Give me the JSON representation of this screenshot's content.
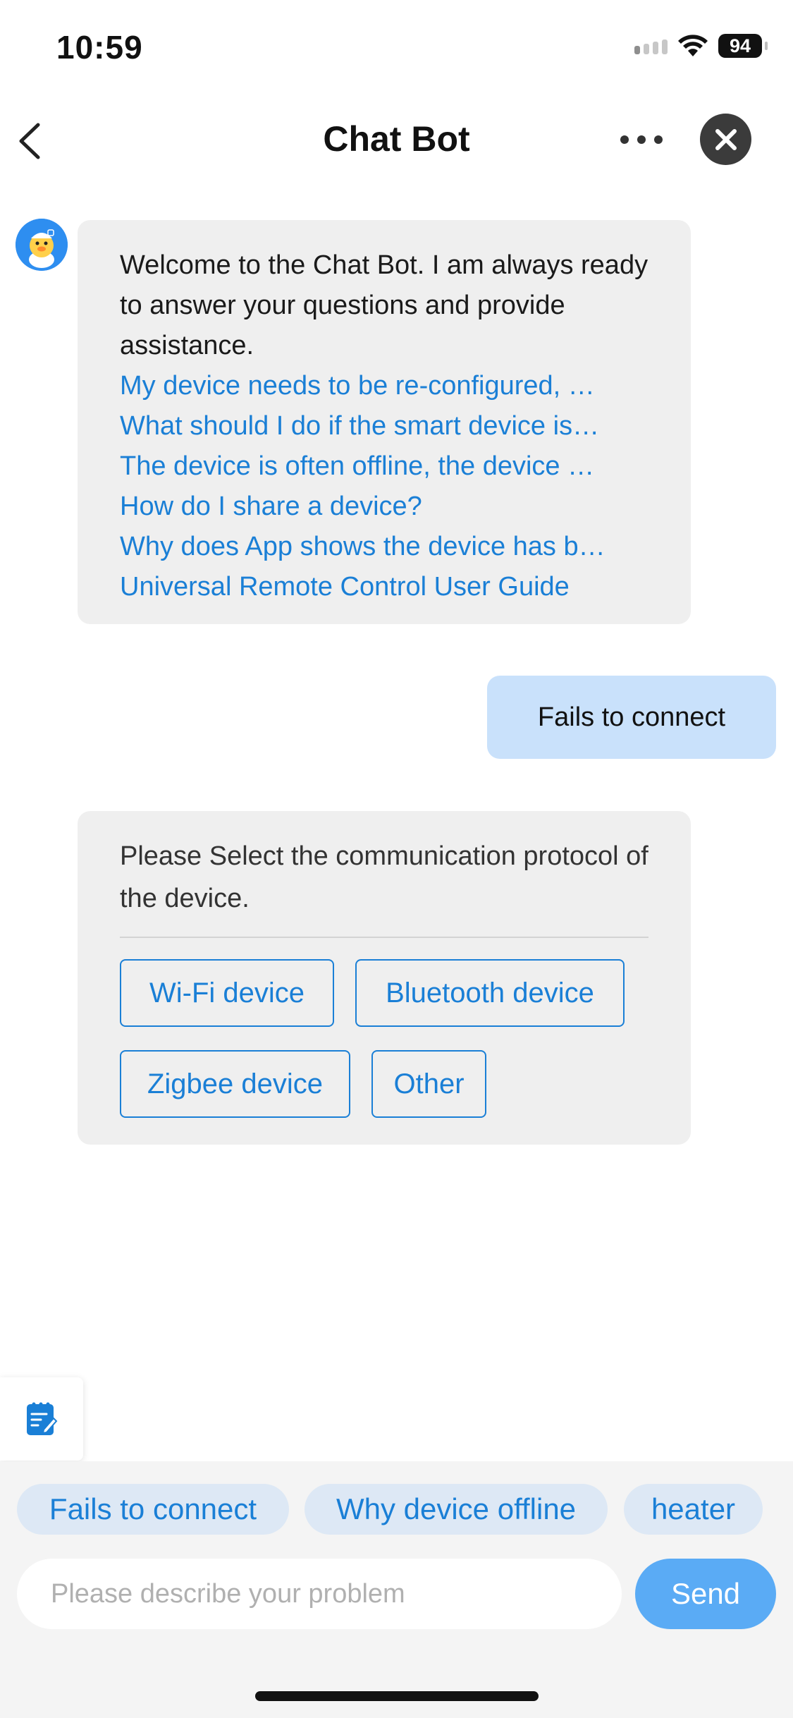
{
  "status_bar": {
    "time": "10:59",
    "battery": "94"
  },
  "header": {
    "title": "Chat Bot",
    "back_icon": "chevron-left-icon",
    "more_icon": "more-horizontal-icon",
    "close_icon": "close-icon"
  },
  "messages": {
    "welcome": {
      "text": "Welcome to the Chat Bot. I am always ready to answer your questions and provide assistance.",
      "links": [
        "My device needs to be re-configured, …",
        "What should I do if the smart device is…",
        "The device is often offline, the device …",
        "How do I share a device?",
        "Why does App shows the device has b…",
        "Universal Remote Control User Guide"
      ]
    },
    "user_message": "Fails to connect",
    "protocol_prompt": {
      "text": "Please Select the communication protocol of the device.",
      "options": [
        "Wi-Fi device",
        "Bluetooth device",
        "Zigbee device",
        "Other"
      ]
    }
  },
  "quick_replies": [
    "Fails to connect",
    "Why device offline",
    "heater"
  ],
  "composer": {
    "placeholder": "Please describe your problem",
    "value": "",
    "send_label": "Send"
  },
  "colors": {
    "accent": "#1a7fd6",
    "send_button": "#5aabf5",
    "user_bubble": "#c9e1fb",
    "bot_bubble": "#efefef",
    "chip_background": "#dde8f5"
  }
}
